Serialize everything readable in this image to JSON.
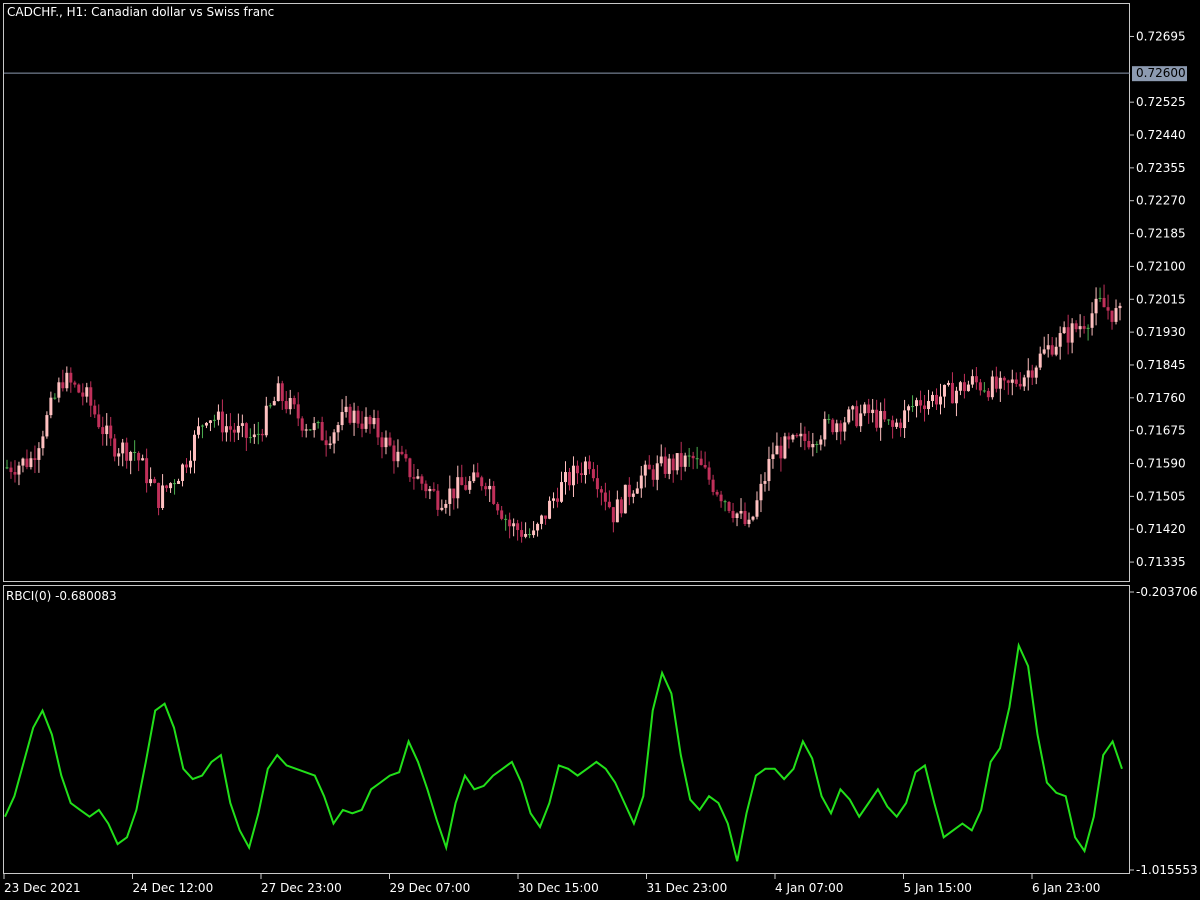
{
  "window": {
    "title": "CADCHF., H1:  Canadian dollar vs Swiss franc",
    "current_price": "0.72600"
  },
  "indicator": {
    "title": "RBCI(0) -0.680083",
    "scale_top": "-0.203706",
    "scale_bottom": "-1.015553"
  },
  "colors": {
    "background": "#000000",
    "bull_candle": "#ffc0c0",
    "bear_candle": "#c0305a",
    "doji_candle": "#4caf50",
    "indicator_line": "#22e01a",
    "price_line": "#8c9ab0",
    "price_tag_bg": "#8c9ab0",
    "frame": "#c8c8c8"
  },
  "chart_data": [
    {
      "type": "candlestick",
      "title": "CADCHF., H1:  Canadian dollar vs Swiss franc",
      "ylim": [
        0.71286,
        0.72779
      ],
      "y_ticks": [
        "0.72695",
        "0.72525",
        "0.72440",
        "0.72355",
        "0.72270",
        "0.72185",
        "0.72100",
        "0.72015",
        "0.71930",
        "0.71845",
        "0.71760",
        "0.71675",
        "0.71590",
        "0.71505",
        "0.71420",
        "0.71335"
      ],
      "current_price": 0.726,
      "x_ticks": [
        "23 Dec 2021",
        "24 Dec 12:00",
        "27 Dec 23:00",
        "29 Dec 07:00",
        "30 Dec 15:00",
        "31 Dec 23:00",
        "4 Jan 07:00",
        "5 Jan 15:00",
        "6 Jan 23:00"
      ],
      "candle_count": 280,
      "close_path": [
        [
          0,
          0.7158
        ],
        [
          6,
          0.716
        ],
        [
          14,
          0.7181
        ],
        [
          20,
          0.7176
        ],
        [
          26,
          0.7164
        ],
        [
          32,
          0.7162
        ],
        [
          38,
          0.715
        ],
        [
          44,
          0.7158
        ],
        [
          50,
          0.7172
        ],
        [
          56,
          0.7168
        ],
        [
          62,
          0.7165
        ],
        [
          68,
          0.7177
        ],
        [
          74,
          0.717
        ],
        [
          80,
          0.7166
        ],
        [
          86,
          0.7172
        ],
        [
          92,
          0.7168
        ],
        [
          100,
          0.7158
        ],
        [
          108,
          0.715
        ],
        [
          114,
          0.7153
        ],
        [
          120,
          0.7155
        ],
        [
          126,
          0.7143
        ],
        [
          132,
          0.714
        ],
        [
          138,
          0.7152
        ],
        [
          146,
          0.716
        ],
        [
          152,
          0.7146
        ],
        [
          158,
          0.7155
        ],
        [
          164,
          0.7158
        ],
        [
          172,
          0.716
        ],
        [
          180,
          0.715
        ],
        [
          186,
          0.7142
        ],
        [
          192,
          0.7162
        ],
        [
          200,
          0.7165
        ],
        [
          208,
          0.717
        ],
        [
          216,
          0.7172
        ],
        [
          222,
          0.7168
        ],
        [
          228,
          0.7175
        ],
        [
          236,
          0.7177
        ],
        [
          242,
          0.718
        ],
        [
          250,
          0.7178
        ],
        [
          256,
          0.7183
        ],
        [
          262,
          0.719
        ],
        [
          268,
          0.7194
        ],
        [
          274,
          0.72
        ],
        [
          279,
          0.7197
        ]
      ]
    },
    {
      "type": "line",
      "title": "RBCI(0) -0.680083",
      "ylim": [
        -1.015553,
        -0.203706
      ],
      "values": [
        -0.86,
        -0.8,
        -0.7,
        -0.6,
        -0.55,
        -0.62,
        -0.74,
        -0.82,
        -0.84,
        -0.86,
        -0.84,
        -0.88,
        -0.94,
        -0.92,
        -0.84,
        -0.7,
        -0.55,
        -0.53,
        -0.6,
        -0.72,
        -0.75,
        -0.74,
        -0.7,
        -0.68,
        -0.82,
        -0.9,
        -0.95,
        -0.85,
        -0.72,
        -0.68,
        -0.71,
        -0.72,
        -0.73,
        -0.74,
        -0.8,
        -0.88,
        -0.84,
        -0.85,
        -0.84,
        -0.78,
        -0.76,
        -0.74,
        -0.73,
        -0.64,
        -0.7,
        -0.78,
        -0.87,
        -0.95,
        -0.82,
        -0.74,
        -0.78,
        -0.77,
        -0.74,
        -0.72,
        -0.7,
        -0.76,
        -0.85,
        -0.89,
        -0.82,
        -0.71,
        -0.72,
        -0.74,
        -0.72,
        -0.7,
        -0.72,
        -0.76,
        -0.82,
        -0.88,
        -0.8,
        -0.55,
        -0.44,
        -0.5,
        -0.68,
        -0.81,
        -0.84,
        -0.8,
        -0.82,
        -0.88,
        -0.99,
        -0.85,
        -0.74,
        -0.72,
        -0.72,
        -0.75,
        -0.72,
        -0.64,
        -0.69,
        -0.8,
        -0.85,
        -0.78,
        -0.81,
        -0.86,
        -0.82,
        -0.78,
        -0.83,
        -0.86,
        -0.82,
        -0.73,
        -0.71,
        -0.82,
        -0.92,
        -0.9,
        -0.88,
        -0.9,
        -0.84,
        -0.7,
        -0.66,
        -0.54,
        -0.36,
        -0.42,
        -0.62,
        -0.76,
        -0.79,
        -0.8,
        -0.92,
        -0.96,
        -0.86,
        -0.68,
        -0.64,
        -0.72
      ]
    }
  ]
}
